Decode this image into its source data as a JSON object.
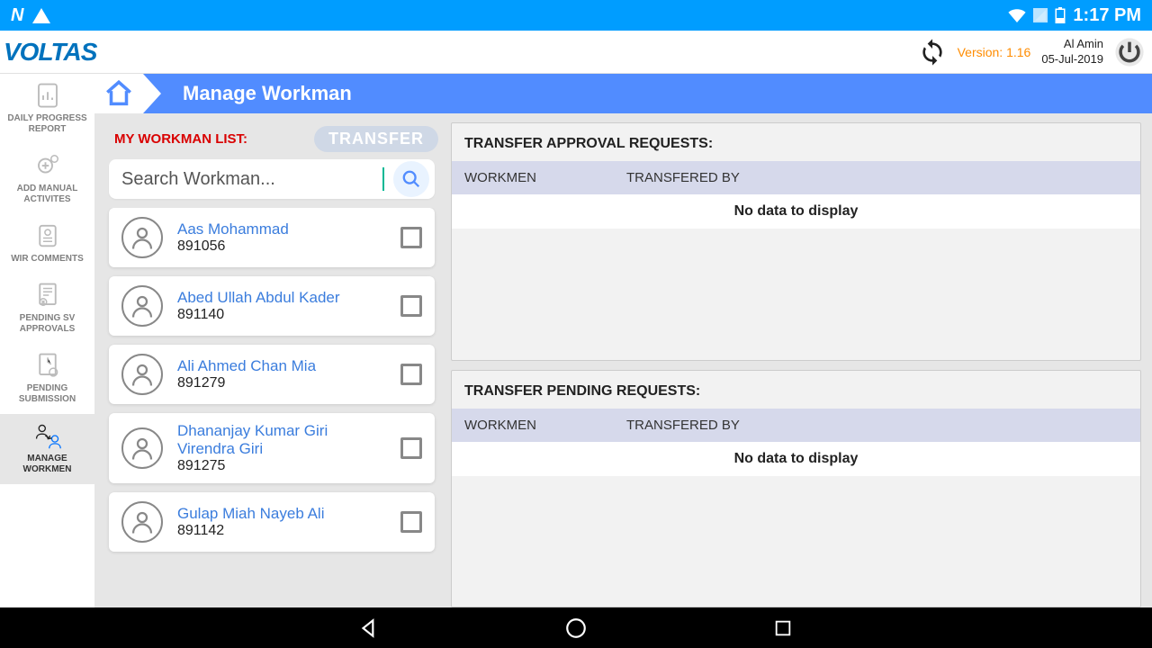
{
  "statusbar": {
    "time": "1:17 PM"
  },
  "header": {
    "logo": "VOLTAS",
    "version": "Version: 1.16",
    "username": "Al Amin",
    "date": "05-Jul-2019"
  },
  "sidebar": {
    "items": [
      {
        "label": "DAILY PROGRESS REPORT"
      },
      {
        "label": "ADD MANUAL ACTIVITES"
      },
      {
        "label": "WIR COMMENTS"
      },
      {
        "label": "PENDING SV APPROVALS"
      },
      {
        "label": "PENDING SUBMISSION"
      },
      {
        "label": "MANAGE WORKMEN"
      }
    ]
  },
  "page": {
    "title": "Manage Workman",
    "list_title": "MY WORKMAN LIST:",
    "transfer_button": "TRANSFER",
    "search_placeholder": "Search Workman..."
  },
  "workmen": [
    {
      "name": "Aas Mohammad",
      "id": "891056"
    },
    {
      "name": "Abed Ullah Abdul Kader",
      "id": "891140"
    },
    {
      "name": "Ali Ahmed Chan Mia",
      "id": "891279"
    },
    {
      "name": "Dhananjay Kumar Giri Virendra Giri",
      "id": "891275"
    },
    {
      "name": "Gulap Miah Nayeb Ali",
      "id": "891142"
    }
  ],
  "requests": {
    "approval": {
      "title": "TRANSFER APPROVAL REQUESTS:",
      "col_workmen": "WORKMEN",
      "col_transby": "TRANSFERED BY",
      "empty": "No data to display"
    },
    "pending": {
      "title": "TRANSFER PENDING REQUESTS:",
      "col_workmen": "WORKMEN",
      "col_transby": "TRANSFERED BY",
      "empty": "No data to display"
    }
  }
}
